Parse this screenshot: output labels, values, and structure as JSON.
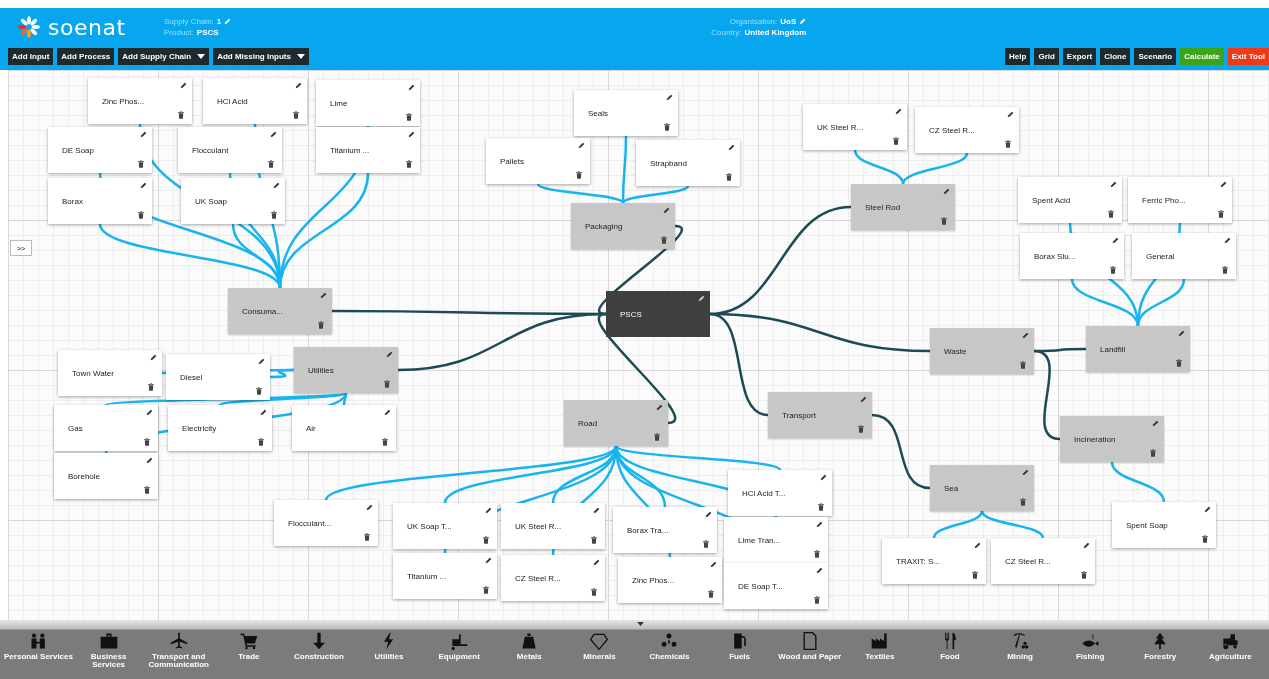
{
  "header": {
    "logo": "soenat",
    "supply_chain_label": "Supply Chain:",
    "supply_chain": "1",
    "product_label": "Product:",
    "product": "PSCS",
    "organisation_label": "Organisation:",
    "organisation": "UoS",
    "country_label": "Country:",
    "country": "United Kingdom"
  },
  "toolbar_left": [
    {
      "label": "Add Input",
      "dropdown": false
    },
    {
      "label": "Add Process",
      "dropdown": false
    },
    {
      "label": "Add Supply Chain",
      "dropdown": true
    },
    {
      "label": "Add Missing Inputs",
      "dropdown": true
    }
  ],
  "toolbar_right": [
    {
      "label": "Help",
      "color": "#1e2a2e"
    },
    {
      "label": "Grid",
      "color": "#1e2a2e"
    },
    {
      "label": "Export",
      "color": "#1e2a2e"
    },
    {
      "label": "Clone",
      "color": "#1e2a2e"
    },
    {
      "label": "Scenario",
      "color": "#1e2a2e"
    },
    {
      "label": "Calculate",
      "color": "#3aa516"
    },
    {
      "label": "Exit Tool",
      "color": "#f03a17"
    }
  ],
  "side_toggle": ">>",
  "nodes": [
    {
      "label": "Zinc Phos...",
      "kind": "input"
    },
    {
      "label": "HCl Acid",
      "kind": "input"
    },
    {
      "label": "Lime",
      "kind": "input"
    },
    {
      "label": "DE Soap",
      "kind": "input"
    },
    {
      "label": "Flocculant",
      "kind": "input"
    },
    {
      "label": "Titanium ...",
      "kind": "input"
    },
    {
      "label": "Borax",
      "kind": "input"
    },
    {
      "label": "UK Soap",
      "kind": "input"
    },
    {
      "label": "Consuma...",
      "kind": "process"
    },
    {
      "label": "Seals",
      "kind": "input"
    },
    {
      "label": "Pallets",
      "kind": "input"
    },
    {
      "label": "Strapband",
      "kind": "input"
    },
    {
      "label": "Packaging",
      "kind": "process"
    },
    {
      "label": "UK Steel R...",
      "kind": "input"
    },
    {
      "label": "CZ Steel R...",
      "kind": "input"
    },
    {
      "label": "Steel Rod",
      "kind": "process"
    },
    {
      "label": "Spent Acid",
      "kind": "input"
    },
    {
      "label": "Ferric Pho...",
      "kind": "input"
    },
    {
      "label": "Borax Slu...",
      "kind": "input"
    },
    {
      "label": "General",
      "kind": "input"
    },
    {
      "label": "Landfill",
      "kind": "process"
    },
    {
      "label": "Waste",
      "kind": "process"
    },
    {
      "label": "PSCS",
      "kind": "product"
    },
    {
      "label": "Town Water",
      "kind": "input"
    },
    {
      "label": "Diesel",
      "kind": "input"
    },
    {
      "label": "Utilities",
      "kind": "process"
    },
    {
      "label": "Gas",
      "kind": "input"
    },
    {
      "label": "Electricity",
      "kind": "input"
    },
    {
      "label": "Air",
      "kind": "input"
    },
    {
      "label": "Borehole",
      "kind": "input"
    },
    {
      "label": "Road",
      "kind": "process"
    },
    {
      "label": "Transport",
      "kind": "process"
    },
    {
      "label": "Incineration",
      "kind": "process"
    },
    {
      "label": "Sea",
      "kind": "process"
    },
    {
      "label": "Spent Soap",
      "kind": "input"
    },
    {
      "label": "Flocculant...",
      "kind": "input"
    },
    {
      "label": "UK Soap T...",
      "kind": "input"
    },
    {
      "label": "UK Steel R...",
      "kind": "input"
    },
    {
      "label": "Borax Tra...",
      "kind": "input"
    },
    {
      "label": "HCl Acid T...",
      "kind": "input"
    },
    {
      "label": "Lime Tran...",
      "kind": "input"
    },
    {
      "label": "Titanium ...",
      "kind": "input"
    },
    {
      "label": "CZ Steel R...",
      "kind": "input"
    },
    {
      "label": "Zinc Phos...",
      "kind": "input"
    },
    {
      "label": "DE Soap T...",
      "kind": "input"
    },
    {
      "label": "TRAXIT: S...",
      "kind": "input"
    },
    {
      "label": "CZ Steel R...",
      "kind": "input"
    }
  ],
  "categories": [
    "Personal Services",
    "Business Services",
    "Transport and Communication",
    "Trade",
    "Construction",
    "Utilities",
    "Equipment",
    "Metals",
    "Minerals",
    "Chemicals",
    "Fuels",
    "Wood and Paper",
    "Textiles",
    "Food",
    "Mining",
    "Fishing",
    "Forestry",
    "Agriculture"
  ]
}
